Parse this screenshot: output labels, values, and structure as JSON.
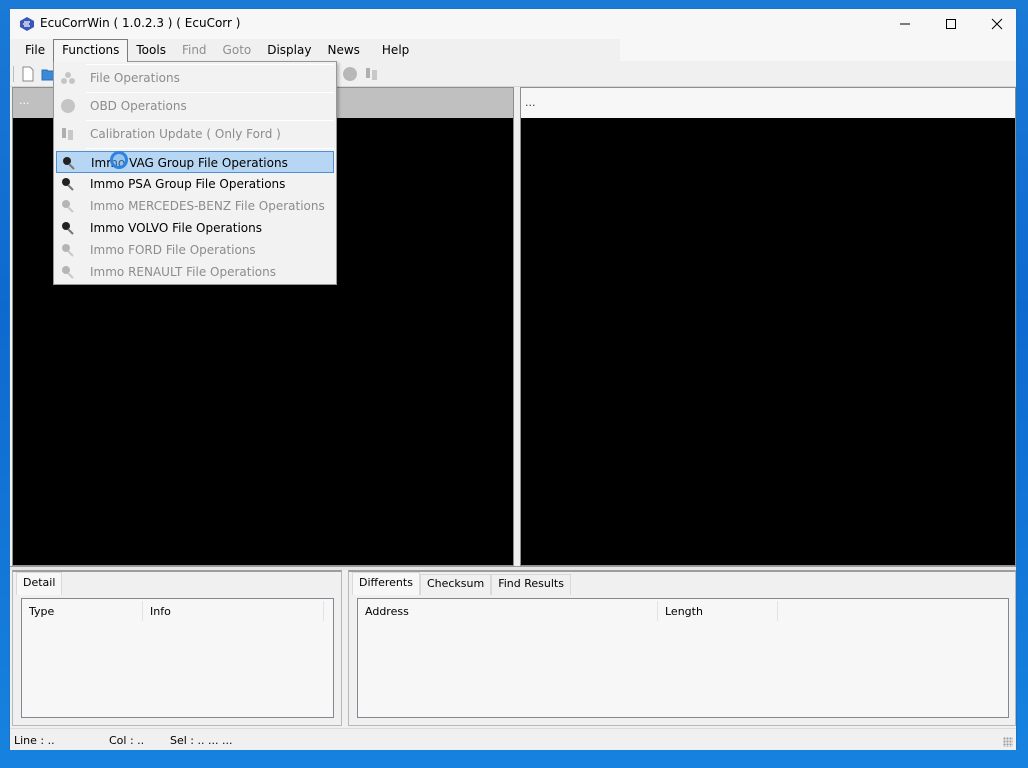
{
  "window": {
    "title": "EcuCorrWin ( 1.0.2.3 ) ( EcuCorr )",
    "controls": [
      "minimize",
      "maximize",
      "close"
    ]
  },
  "menubar": {
    "items": [
      {
        "label": "File",
        "enabled": true
      },
      {
        "label": "Functions",
        "enabled": true,
        "open": true
      },
      {
        "label": "Tools",
        "enabled": true
      },
      {
        "label": "Find",
        "enabled": false
      },
      {
        "label": "Goto",
        "enabled": false
      },
      {
        "label": "Display",
        "enabled": true
      },
      {
        "label": "News",
        "enabled": true
      },
      {
        "label": "Help",
        "enabled": true
      }
    ]
  },
  "toolbar": {
    "icons": [
      "new-file-icon",
      "open-folder-icon",
      "obd-icon",
      "calibration-icon"
    ]
  },
  "functions_menu": {
    "items": [
      {
        "label": "File Operations",
        "enabled": false,
        "icon": "file-operations-icon"
      },
      {
        "label": "OBD Operations",
        "enabled": false,
        "icon": "obd-icon"
      },
      {
        "label": "Calibration Update ( Only Ford )",
        "enabled": false,
        "icon": "calibration-icon"
      },
      {
        "label": "Immo VAG Group File Operations",
        "enabled": true,
        "icon": "immo-key-icon",
        "highlighted": true
      },
      {
        "label": "Immo PSA Group File Operations",
        "enabled": true,
        "icon": "immo-key-icon"
      },
      {
        "label": "Immo MERCEDES-BENZ File Operations",
        "enabled": false,
        "icon": "immo-key-icon"
      },
      {
        "label": "Immo VOLVO File Operations",
        "enabled": true,
        "icon": "immo-key-icon"
      },
      {
        "label": "Immo FORD File Operations",
        "enabled": false,
        "icon": "immo-key-icon"
      },
      {
        "label": "Immo RENAULT File Operations",
        "enabled": false,
        "icon": "immo-key-icon"
      }
    ]
  },
  "editor": {
    "left_pane_header": "...",
    "right_pane_header": "..."
  },
  "detail_panel": {
    "tabs": [
      "Detail"
    ],
    "active_tab": "Detail",
    "columns": [
      "Type",
      "Info"
    ]
  },
  "results_panel": {
    "tabs": [
      "Differents",
      "Checksum",
      "Find Results"
    ],
    "active_tab": "Differents",
    "columns": [
      "Address",
      "Length"
    ]
  },
  "statusbar": {
    "line": "Line :  ..",
    "col": "Col :  ..",
    "sel": "Sel :  ..  ...  ..."
  }
}
